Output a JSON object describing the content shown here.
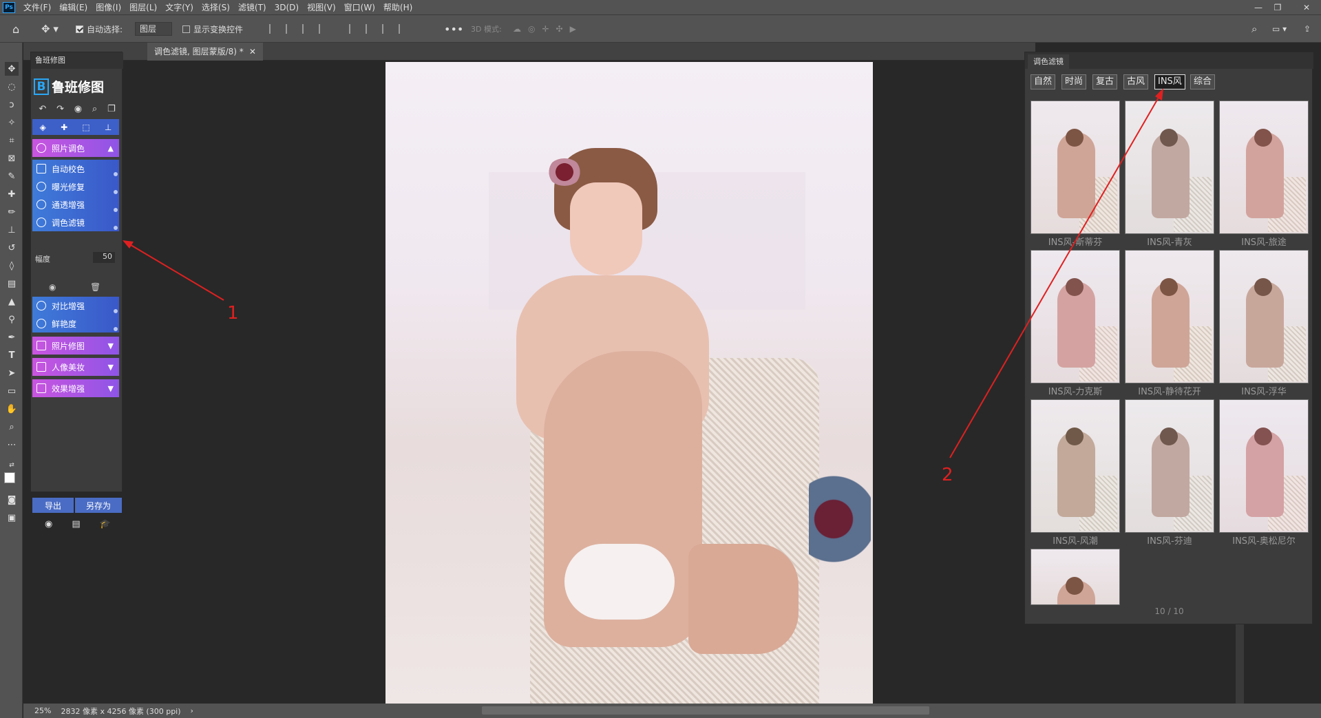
{
  "menubar": {
    "logo": "Ps",
    "items": [
      "文件(F)",
      "编辑(E)",
      "图像(I)",
      "图层(L)",
      "文字(Y)",
      "选择(S)",
      "滤镜(T)",
      "3D(D)",
      "视图(V)",
      "窗口(W)",
      "帮助(H)"
    ]
  },
  "options": {
    "auto_select_label": "自动选择:",
    "auto_select_value": "图层",
    "show_transform_label": "显示变换控件",
    "mode3d_label": "3D 模式:"
  },
  "document": {
    "tab_title": "调色滤镜, 图层蒙版/8) *"
  },
  "left_panel": {
    "title": "鲁班修图",
    "logo_text": "鲁班修图",
    "photo_grading": "照片调色",
    "auto_color": "自动校色",
    "exposure_fix": "曝光修复",
    "clarity": "通透增强",
    "color_filter": "调色滤镜",
    "amount_label": "幅度",
    "amount_value": "50",
    "amount_fraction": 0.5,
    "contrast": "对比增强",
    "vibrance": "鲜艳度",
    "photo_retouch": "照片修图",
    "portrait_beauty": "人像美妆",
    "effect_enhance": "效果增强",
    "export": "导出",
    "save_as": "另存为"
  },
  "right_panel": {
    "title": "调色滤镜",
    "categories": [
      "自然",
      "时尚",
      "复古",
      "古风",
      "INS风",
      "综合"
    ],
    "active_category": "INS风",
    "thumbs": [
      "INS风-斯蒂芬",
      "INS风-青灰",
      "INS风-旅途",
      "INS风-力克斯",
      "INS风-静待花开",
      "INS风-浮华",
      "INS风-风潮",
      "INS风-芬迪",
      "INS风-奥松尼尔"
    ],
    "page": "10 / 10"
  },
  "status": {
    "zoom": "25%",
    "info": "2832 像素 x 4256 像素 (300 ppi)"
  },
  "annotations": {
    "label1": "1",
    "label2": "2",
    "color": "#e02020"
  }
}
